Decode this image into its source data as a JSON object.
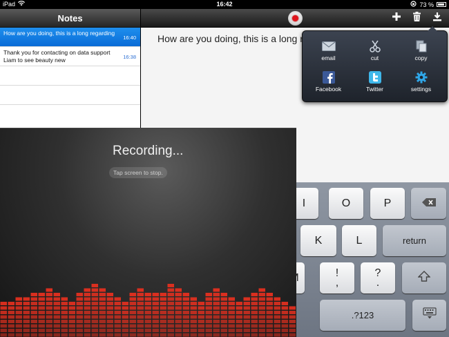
{
  "status_bar": {
    "device": "iPad",
    "time": "16:42",
    "battery": "73 %"
  },
  "sidebar": {
    "title": "Notes",
    "notes": [
      {
        "text": "How are you doing, this is a long regarding",
        "time": "16:40",
        "selected": true
      },
      {
        "text": "Thank you for contacting on data support Liam to see beauty new",
        "time": "16:38",
        "selected": false
      }
    ]
  },
  "editor": {
    "text": "How are you doing, this is a long regarding"
  },
  "share_menu": {
    "items": [
      {
        "label": "email",
        "icon": "email-icon"
      },
      {
        "label": "cut",
        "icon": "scissors-icon"
      },
      {
        "label": "copy",
        "icon": "copy-icon"
      },
      {
        "label": "Facebook",
        "icon": "facebook-icon"
      },
      {
        "label": "Twitter",
        "icon": "twitter-icon"
      },
      {
        "label": "settings",
        "icon": "gear-icon"
      }
    ]
  },
  "recorder": {
    "title": "Recording...",
    "hint": "Tap screen to stop.",
    "bar_color": "#e2301f",
    "levels": [
      0.55,
      0.58,
      0.62,
      0.62,
      0.68,
      0.72,
      0.78,
      0.72,
      0.66,
      0.6,
      0.72,
      0.82,
      0.86,
      0.8,
      0.72,
      0.66,
      0.6,
      0.72,
      0.78,
      0.74,
      0.68,
      0.72,
      0.86,
      0.8,
      0.74,
      0.66,
      0.6,
      0.7,
      0.78,
      0.72,
      0.64,
      0.58,
      0.64,
      0.72,
      0.8,
      0.72,
      0.62,
      0.55,
      0.48
    ]
  },
  "keyboard": {
    "keys": {
      "i": "I",
      "o": "O",
      "p": "P",
      "k": "K",
      "l": "L",
      "return": "return",
      "m": "M",
      "exclam": "!",
      "exclam2": ",",
      "question": "?",
      "question2": ".",
      "numbers": ".?123"
    }
  }
}
